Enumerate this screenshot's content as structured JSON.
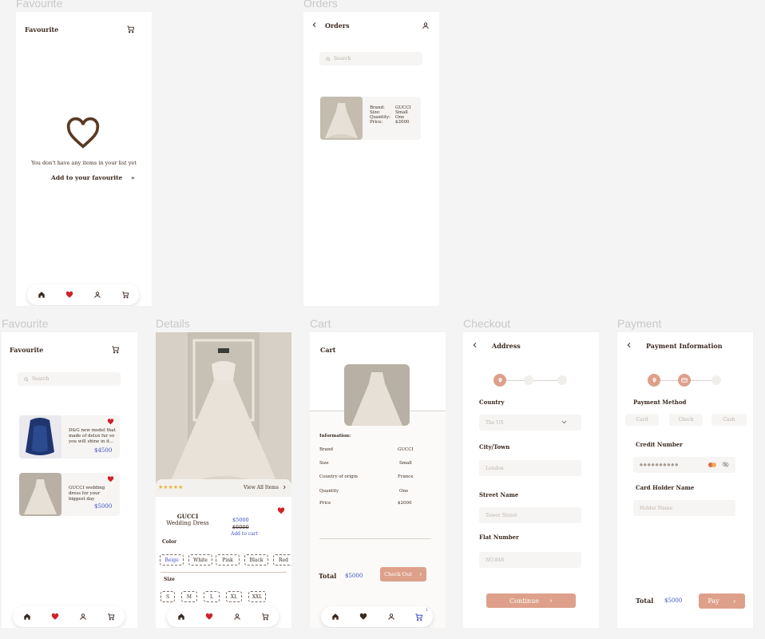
{
  "labels": {
    "fav1": "Favourite",
    "orders": "Orders",
    "fav2": "Favourite",
    "details": "Details",
    "cart": "Cart",
    "checkout": "Checkout",
    "payment": "Payment"
  },
  "fav_empty": {
    "title": "Favourite",
    "empty_text": "You don't have any items in your list yet",
    "add_link": "Add to your favourite",
    "add_chevron": "»"
  },
  "orders": {
    "title": "Orders",
    "search_placeholder": "Search",
    "item": {
      "brand_label": "Brand:",
      "brand": "GUCCI",
      "size_label": "Size:",
      "size": "Small",
      "qty_label": "Quantity:",
      "qty": "One",
      "price_label": "Price:",
      "price": "$2000"
    }
  },
  "fav_list": {
    "title": "Favourite",
    "search_placeholder": "Search",
    "items": [
      {
        "desc": "D&G new model that made of delux fur so you will shine in it...",
        "price": "$4500"
      },
      {
        "desc": "GUCCI wedding dress for your biggest day",
        "price": "$5000"
      }
    ]
  },
  "details": {
    "stars": "★★★★★",
    "view_all": "View All Items",
    "brand": "GUCCI",
    "name": "Wedding Dress",
    "price": "$5000",
    "old_price": "$6000",
    "add_to_cart": "Add to cart",
    "color_label": "Color",
    "colors": [
      "Beige",
      "White",
      "Pink",
      "Black",
      "Red"
    ],
    "size_label": "Size",
    "sizes": [
      "S",
      "M",
      "L",
      "XL",
      "XXL"
    ]
  },
  "cart": {
    "title": "Cart",
    "info_label": "Information:",
    "rows": [
      {
        "k": "Brand",
        "v": "GUCCI"
      },
      {
        "k": "Size",
        "v": "Small"
      },
      {
        "k": "Country of origin",
        "v": "France"
      },
      {
        "k": "Quantity",
        "v": "One"
      },
      {
        "k": "Price",
        "v": "$2000"
      }
    ],
    "total_label": "Total",
    "total": "$5000",
    "checkout": "Check Out",
    "badge": "1"
  },
  "checkout": {
    "title": "Address",
    "country_label": "Country",
    "country_value": "The US",
    "city_label": "City/Town",
    "city_placeholder": "London",
    "street_label": "Street Name",
    "street_placeholder": "Tower Street",
    "flat_label": "Flat Number",
    "flat_placeholder": "NO.848",
    "continue": "Continue"
  },
  "payment": {
    "title": "Payment Information",
    "method_label": "Payment Method",
    "methods": [
      "Card",
      "Check",
      "Cash"
    ],
    "credit_label": "Credit Number",
    "credit_mask": "●●●●●●●●●●",
    "holder_label": "Card Holder Name",
    "holder_placeholder": "Holder Name",
    "total_label": "Total",
    "total": "$5000",
    "pay": "Pay"
  },
  "colors": {
    "accent": "#dea08a",
    "heart": "#d0202a",
    "price": "#3f4fc8",
    "brown": "#5a3a22"
  }
}
